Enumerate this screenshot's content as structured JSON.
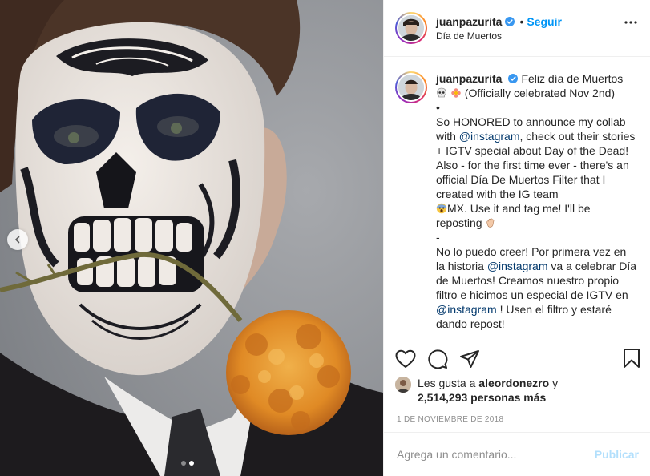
{
  "post": {
    "username": "juanpazurita",
    "follow_label": "Seguir",
    "bullet": "•",
    "location": "Día de Muertos",
    "caption_lines": [
      "Feliz día de Muertos",
      "(Officially celebrated Nov 2nd)",
      "•",
      "So HONORED to announce my collab with",
      "@instagram",
      ", check out their stories + IGTV special about Day of the Dead! Also - for the first time ever - there's an official Día De Muertos Filter that I created with the IG team",
      "MX. Use it and tag me! I'll be reposting",
      "-",
      "No lo puedo creer! Por primera vez en la historia",
      "@instagram",
      "va a celebrar Día de Muertos! Creamos nuestro propio filtro e hicimos un especial de IGTV en",
      "@instagram",
      "! Usen el filtro y estaré dando repost!"
    ],
    "likes_prefix": "Les gusta a",
    "likes_user": "aleordonezro",
    "likes_and": "y",
    "likes_count": "2,514,293 personas más",
    "date": "1 de noviembre de 2018",
    "comment_placeholder": "Agrega un comentario...",
    "publish_label": "Publicar",
    "carousel": {
      "total": 2,
      "active": 2
    }
  },
  "icons": {
    "verified": "verified-badge-icon",
    "more": "more-options-icon",
    "like": "heart-icon",
    "comment": "comment-bubble-icon",
    "share": "paper-plane-icon",
    "save": "bookmark-icon",
    "prev": "chevron-left-icon"
  },
  "colors": {
    "link": "#0095f6",
    "mention": "#00376b",
    "verified": "#3897f0",
    "muted": "#8e8e8e"
  }
}
